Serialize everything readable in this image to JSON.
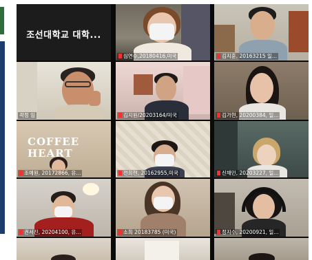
{
  "meeting": {
    "featured_name": "조선대학교 대학...",
    "participants": [
      {
        "id": "p1",
        "label": "심연수,20180416,미국"
      },
      {
        "id": "p2",
        "label": "김지훈, 20163215 일..."
      },
      {
        "id": "p3",
        "label": "곽정 임"
      },
      {
        "id": "p4",
        "label": "김지원/20203164/미국"
      },
      {
        "id": "p5",
        "label": "김가현, 20200384, 일..."
      },
      {
        "id": "p6",
        "label": "조예원, 20172866, 유..."
      },
      {
        "id": "p7",
        "label": "전희현, 20162955,미국"
      },
      {
        "id": "p8",
        "label": "신채민, 20203227, 일..."
      },
      {
        "id": "p9",
        "label": "권서진, 20204100, 유..."
      },
      {
        "id": "p10",
        "label": "소희 20183785 (미국)"
      },
      {
        "id": "p11",
        "label": "정지수, 20200921, 일..."
      }
    ],
    "background_sign": [
      "COFFEE",
      "HEART"
    ]
  },
  "colors": {
    "grid_background": "#0a0a0a",
    "name_text": "#ffffff",
    "accent_blue": "#1c3d6b",
    "accent_green": "#2d6e3a"
  }
}
